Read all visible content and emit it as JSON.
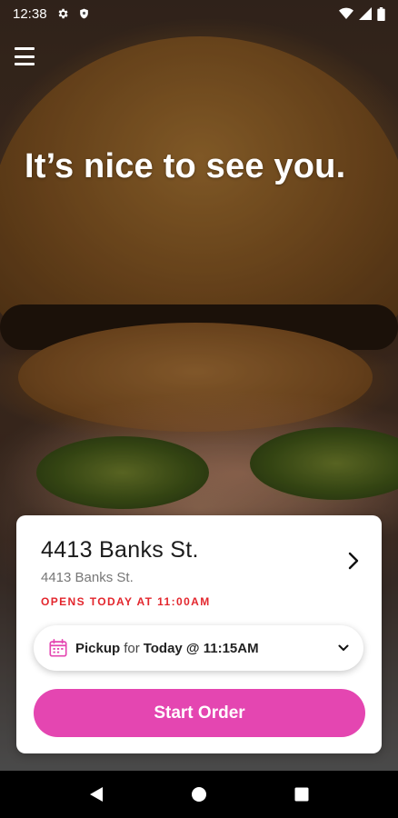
{
  "status_bar": {
    "time": "12:38",
    "left_icons": [
      "gear-icon",
      "shield-icon"
    ],
    "right_icons": [
      "wifi-icon",
      "signal-icon",
      "battery-icon"
    ]
  },
  "header": {
    "menu_icon": "hamburger-menu-icon",
    "headline": "It’s nice to see you."
  },
  "location_card": {
    "title": "4413 Banks St.",
    "address": "4413 Banks St.",
    "hours_status": "OPENS TODAY AT 11:00AM",
    "hours_color": "#e3262d",
    "chevron_icon": "chevron-right-icon"
  },
  "order_options": {
    "mode": "Pickup",
    "connector": "for",
    "time": "Today @ 11:15AM",
    "calendar_icon": "calendar-icon",
    "calendar_color": "#e446b1",
    "dropdown_icon": "chevron-down-icon"
  },
  "actions": {
    "start_order_label": "Start Order",
    "accent_color": "#e446b1"
  },
  "nav_bar": {
    "buttons": [
      "back-triangle-icon",
      "home-circle-icon",
      "recents-square-icon"
    ]
  }
}
